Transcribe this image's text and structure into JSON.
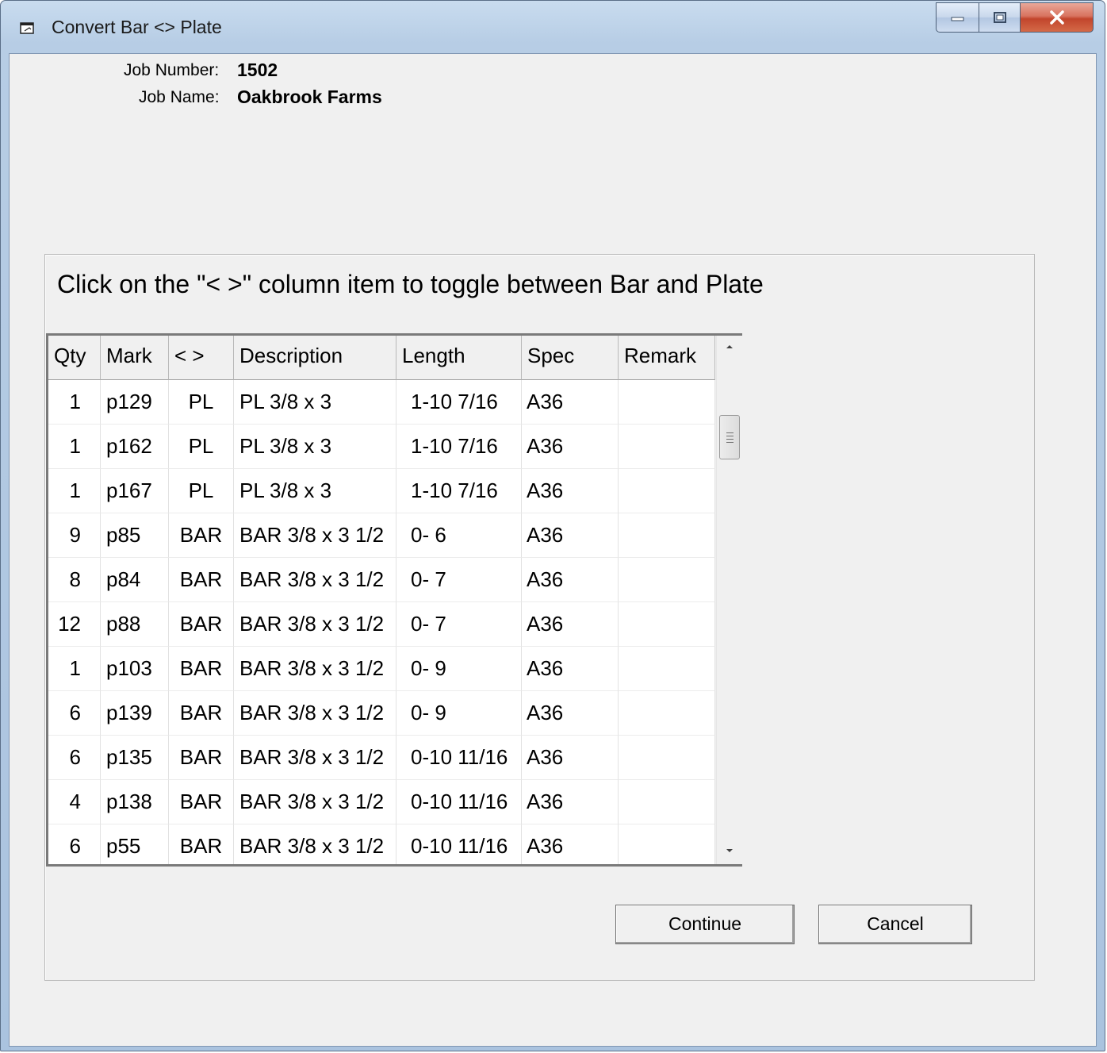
{
  "window": {
    "title": "Convert Bar <> Plate",
    "app_icon": "window-app-icon"
  },
  "job": {
    "number_label": "Job Number:",
    "number_value": "1502",
    "name_label": "Job Name:",
    "name_value": "Oakbrook Farms"
  },
  "instructions": "Click on the \"<  >\" column item to toggle between Bar and Plate",
  "grid": {
    "columns": [
      "Qty",
      "Mark",
      "< >",
      "Description",
      "Length",
      "Spec",
      "Remark"
    ],
    "rows": [
      [
        "1",
        "p129",
        "PL",
        "PL 3/8 x 3",
        "1-10 7/16",
        "A36",
        ""
      ],
      [
        "1",
        "p162",
        "PL",
        "PL 3/8 x 3",
        "1-10 7/16",
        "A36",
        ""
      ],
      [
        "1",
        "p167",
        "PL",
        "PL 3/8 x 3",
        "1-10 7/16",
        "A36",
        ""
      ],
      [
        "9",
        "p85",
        "BAR",
        "BAR 3/8 x 3 1/2",
        "0- 6",
        "A36",
        ""
      ],
      [
        "8",
        "p84",
        "BAR",
        "BAR 3/8 x 3 1/2",
        "0- 7",
        "A36",
        ""
      ],
      [
        "12",
        "p88",
        "BAR",
        "BAR 3/8 x 3 1/2",
        "0- 7",
        "A36",
        ""
      ],
      [
        "1",
        "p103",
        "BAR",
        "BAR 3/8 x 3 1/2",
        "0- 9",
        "A36",
        ""
      ],
      [
        "6",
        "p139",
        "BAR",
        "BAR 3/8 x 3 1/2",
        "0- 9",
        "A36",
        ""
      ],
      [
        "6",
        "p135",
        "BAR",
        "BAR 3/8 x 3 1/2",
        "0-10 11/16",
        "A36",
        ""
      ],
      [
        "4",
        "p138",
        "BAR",
        "BAR 3/8 x 3 1/2",
        "0-10 11/16",
        "A36",
        ""
      ],
      [
        "6",
        "p55",
        "BAR",
        "BAR 3/8 x 3 1/2",
        "0-10 11/16",
        "A36",
        ""
      ]
    ]
  },
  "buttons": {
    "continue": "Continue",
    "cancel": "Cancel"
  },
  "colors": {
    "titlebar": "#b7cde5",
    "client_bg": "#f0f0f0",
    "close_button": "#c2452c"
  }
}
